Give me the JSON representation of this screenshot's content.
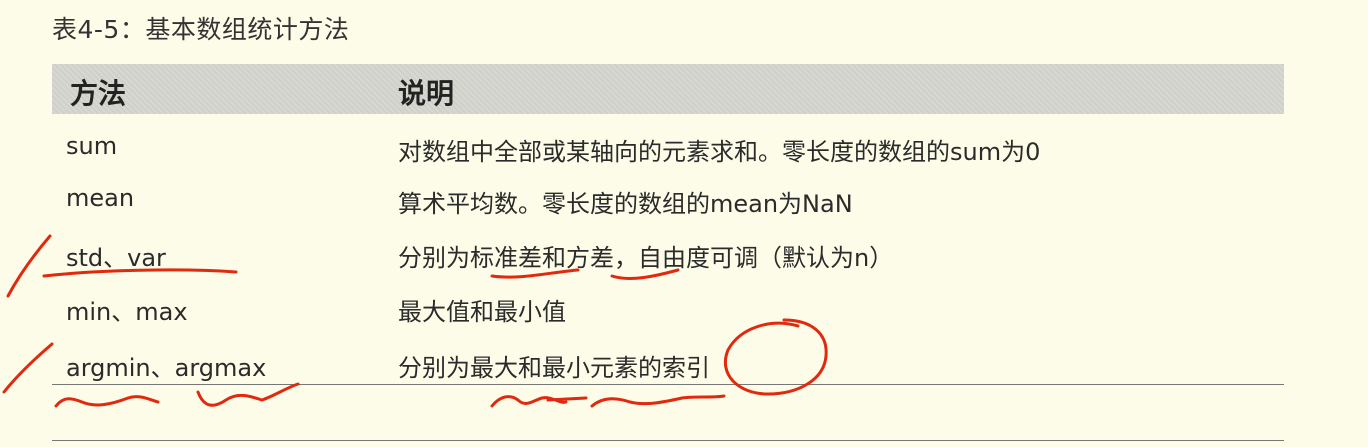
{
  "caption": "表4-5：基本数组统计方法",
  "table": {
    "headers": {
      "method": "方法",
      "description": "说明"
    },
    "rows": [
      {
        "method": "sum",
        "description": "对数组中全部或某轴向的元素求和。零长度的数组的sum为0"
      },
      {
        "method": "mean",
        "description": "算术平均数。零长度的数组的mean为NaN"
      },
      {
        "method": "std、var",
        "description": "分别为标准差和方差，自由度可调（默认为n）"
      },
      {
        "method": "min、max",
        "description": "最大值和最小值"
      },
      {
        "method": "argmin、argmax",
        "description": "分别为最大和最小元素的索引"
      }
    ]
  },
  "annotation_color": "#e0290e"
}
